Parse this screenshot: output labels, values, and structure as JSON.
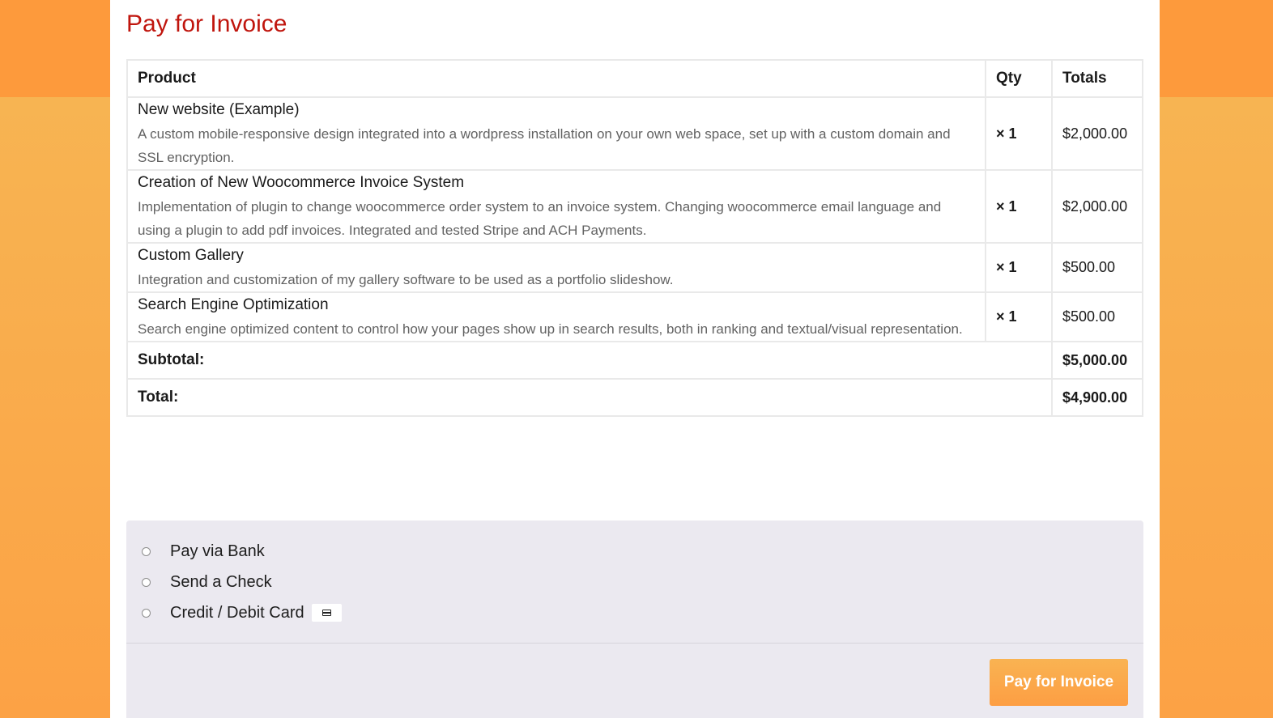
{
  "page": {
    "title": "Pay for Invoice"
  },
  "table": {
    "headers": {
      "product": "Product",
      "qty": "Qty",
      "totals": "Totals"
    },
    "items": [
      {
        "name": "New website (Example)",
        "description": "A custom mobile-responsive design integrated into a wordpress installation on your own web space, set up with a custom domain and SSL encryption.",
        "qty": "× 1",
        "total": "$2,000.00"
      },
      {
        "name": "Creation of New Woocommerce Invoice System",
        "description": "Implementation of plugin to change woocommerce order system to an invoice system. Changing woocommerce email language and using a plugin to add pdf invoices. Integrated and tested Stripe and ACH Payments.",
        "qty": "× 1",
        "total": "$2,000.00"
      },
      {
        "name": "Custom Gallery",
        "description": "Integration and customization of my gallery software to be used as a portfolio slideshow.",
        "qty": "× 1",
        "total": "$500.00"
      },
      {
        "name": "Search Engine Optimization",
        "description": "Search engine optimized content to control how your pages show up in search results, both in ranking and textual/visual representation.",
        "qty": "× 1",
        "total": "$500.00"
      }
    ],
    "subtotal": {
      "label": "Subtotal:",
      "value": "$5,000.00"
    },
    "total": {
      "label": "Total:",
      "value": "$4,900.00"
    }
  },
  "payment": {
    "methods": [
      {
        "label": "Pay via Bank",
        "selected": false
      },
      {
        "label": "Send a Check",
        "selected": false
      },
      {
        "label": "Credit / Debit Card",
        "selected": false,
        "icon": "credit-card-icon"
      }
    ],
    "submit_label": "Pay for Invoice"
  },
  "colors": {
    "title": "#c0150d",
    "background_top": "#fd9a3c",
    "background": "#f8b150",
    "payment_panel": "#ebe9f0",
    "button": "#fca245"
  }
}
